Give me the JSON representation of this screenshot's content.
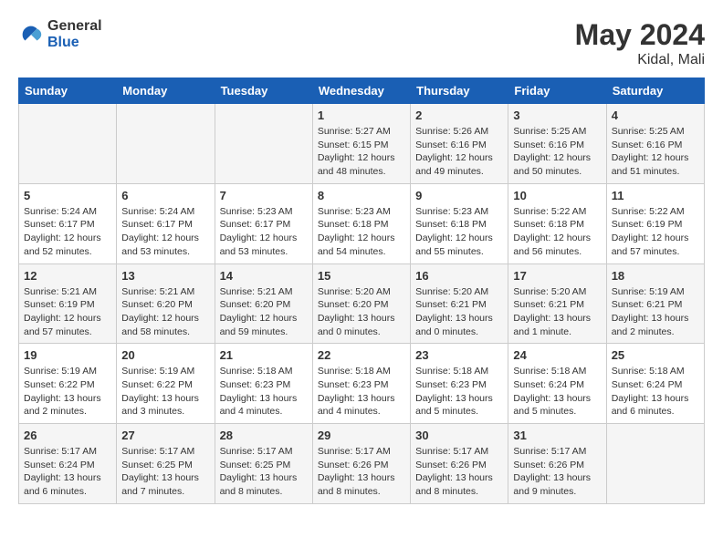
{
  "logo": {
    "line1": "General",
    "line2": "Blue"
  },
  "title": {
    "month_year": "May 2024",
    "location": "Kidal, Mali"
  },
  "headers": [
    "Sunday",
    "Monday",
    "Tuesday",
    "Wednesday",
    "Thursday",
    "Friday",
    "Saturday"
  ],
  "weeks": [
    [
      {
        "day": "",
        "info": ""
      },
      {
        "day": "",
        "info": ""
      },
      {
        "day": "",
        "info": ""
      },
      {
        "day": "1",
        "info": "Sunrise: 5:27 AM\nSunset: 6:15 PM\nDaylight: 12 hours\nand 48 minutes."
      },
      {
        "day": "2",
        "info": "Sunrise: 5:26 AM\nSunset: 6:16 PM\nDaylight: 12 hours\nand 49 minutes."
      },
      {
        "day": "3",
        "info": "Sunrise: 5:25 AM\nSunset: 6:16 PM\nDaylight: 12 hours\nand 50 minutes."
      },
      {
        "day": "4",
        "info": "Sunrise: 5:25 AM\nSunset: 6:16 PM\nDaylight: 12 hours\nand 51 minutes."
      }
    ],
    [
      {
        "day": "5",
        "info": "Sunrise: 5:24 AM\nSunset: 6:17 PM\nDaylight: 12 hours\nand 52 minutes."
      },
      {
        "day": "6",
        "info": "Sunrise: 5:24 AM\nSunset: 6:17 PM\nDaylight: 12 hours\nand 53 minutes."
      },
      {
        "day": "7",
        "info": "Sunrise: 5:23 AM\nSunset: 6:17 PM\nDaylight: 12 hours\nand 53 minutes."
      },
      {
        "day": "8",
        "info": "Sunrise: 5:23 AM\nSunset: 6:18 PM\nDaylight: 12 hours\nand 54 minutes."
      },
      {
        "day": "9",
        "info": "Sunrise: 5:23 AM\nSunset: 6:18 PM\nDaylight: 12 hours\nand 55 minutes."
      },
      {
        "day": "10",
        "info": "Sunrise: 5:22 AM\nSunset: 6:18 PM\nDaylight: 12 hours\nand 56 minutes."
      },
      {
        "day": "11",
        "info": "Sunrise: 5:22 AM\nSunset: 6:19 PM\nDaylight: 12 hours\nand 57 minutes."
      }
    ],
    [
      {
        "day": "12",
        "info": "Sunrise: 5:21 AM\nSunset: 6:19 PM\nDaylight: 12 hours\nand 57 minutes."
      },
      {
        "day": "13",
        "info": "Sunrise: 5:21 AM\nSunset: 6:20 PM\nDaylight: 12 hours\nand 58 minutes."
      },
      {
        "day": "14",
        "info": "Sunrise: 5:21 AM\nSunset: 6:20 PM\nDaylight: 12 hours\nand 59 minutes."
      },
      {
        "day": "15",
        "info": "Sunrise: 5:20 AM\nSunset: 6:20 PM\nDaylight: 13 hours\nand 0 minutes."
      },
      {
        "day": "16",
        "info": "Sunrise: 5:20 AM\nSunset: 6:21 PM\nDaylight: 13 hours\nand 0 minutes."
      },
      {
        "day": "17",
        "info": "Sunrise: 5:20 AM\nSunset: 6:21 PM\nDaylight: 13 hours\nand 1 minute."
      },
      {
        "day": "18",
        "info": "Sunrise: 5:19 AM\nSunset: 6:21 PM\nDaylight: 13 hours\nand 2 minutes."
      }
    ],
    [
      {
        "day": "19",
        "info": "Sunrise: 5:19 AM\nSunset: 6:22 PM\nDaylight: 13 hours\nand 2 minutes."
      },
      {
        "day": "20",
        "info": "Sunrise: 5:19 AM\nSunset: 6:22 PM\nDaylight: 13 hours\nand 3 minutes."
      },
      {
        "day": "21",
        "info": "Sunrise: 5:18 AM\nSunset: 6:23 PM\nDaylight: 13 hours\nand 4 minutes."
      },
      {
        "day": "22",
        "info": "Sunrise: 5:18 AM\nSunset: 6:23 PM\nDaylight: 13 hours\nand 4 minutes."
      },
      {
        "day": "23",
        "info": "Sunrise: 5:18 AM\nSunset: 6:23 PM\nDaylight: 13 hours\nand 5 minutes."
      },
      {
        "day": "24",
        "info": "Sunrise: 5:18 AM\nSunset: 6:24 PM\nDaylight: 13 hours\nand 5 minutes."
      },
      {
        "day": "25",
        "info": "Sunrise: 5:18 AM\nSunset: 6:24 PM\nDaylight: 13 hours\nand 6 minutes."
      }
    ],
    [
      {
        "day": "26",
        "info": "Sunrise: 5:17 AM\nSunset: 6:24 PM\nDaylight: 13 hours\nand 6 minutes."
      },
      {
        "day": "27",
        "info": "Sunrise: 5:17 AM\nSunset: 6:25 PM\nDaylight: 13 hours\nand 7 minutes."
      },
      {
        "day": "28",
        "info": "Sunrise: 5:17 AM\nSunset: 6:25 PM\nDaylight: 13 hours\nand 8 minutes."
      },
      {
        "day": "29",
        "info": "Sunrise: 5:17 AM\nSunset: 6:26 PM\nDaylight: 13 hours\nand 8 minutes."
      },
      {
        "day": "30",
        "info": "Sunrise: 5:17 AM\nSunset: 6:26 PM\nDaylight: 13 hours\nand 8 minutes."
      },
      {
        "day": "31",
        "info": "Sunrise: 5:17 AM\nSunset: 6:26 PM\nDaylight: 13 hours\nand 9 minutes."
      },
      {
        "day": "",
        "info": ""
      }
    ]
  ]
}
